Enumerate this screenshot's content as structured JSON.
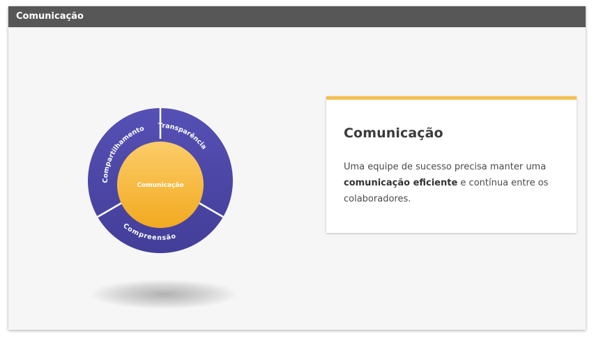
{
  "window": {
    "title": "Comunicação"
  },
  "diagram": {
    "center": "Comunicação",
    "segments": [
      {
        "label": "Transparência"
      },
      {
        "label": "Compreensão"
      },
      {
        "label": "Compartilhamento"
      }
    ],
    "colors": {
      "ring": "#4d48a6",
      "core_top": "#fbc964",
      "core_bottom": "#f2ab22"
    }
  },
  "card": {
    "title": "Comunicação",
    "text_before": "Uma equipe de sucesso precisa manter uma ",
    "text_bold": "comunicação eficiente",
    "text_after": " e contínua entre os colaboradores.",
    "accent_color": "#f4c052"
  }
}
